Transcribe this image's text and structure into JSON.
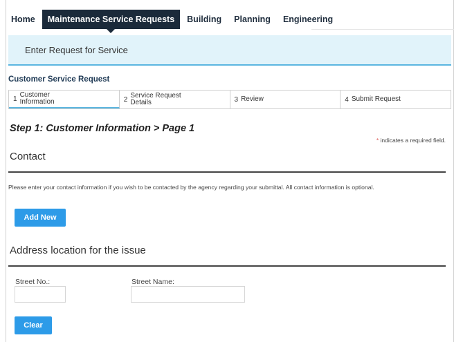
{
  "nav": {
    "items": [
      {
        "label": "Home"
      },
      {
        "label": "Maintenance Service Requests",
        "active": true
      },
      {
        "label": "Building"
      },
      {
        "label": "Planning"
      },
      {
        "label": "Engineering"
      }
    ]
  },
  "banner": {
    "text": "Enter Request for Service"
  },
  "form": {
    "title": "Customer Service Request",
    "steps": [
      {
        "num": "1",
        "label": "Customer\nInformation",
        "active": true
      },
      {
        "num": "2",
        "label": "Service Request\nDetails"
      },
      {
        "num": "3",
        "label": "Review"
      },
      {
        "num": "4",
        "label": "Submit Request"
      }
    ],
    "step_title": "Step 1: Customer Information > Page 1",
    "required_star": "*",
    "required_note": " indicates a required field."
  },
  "contact": {
    "title": "Contact",
    "info": "Please enter your contact information if you wish to be contacted by the agency regarding your submittal.  All contact information is optional.",
    "add_button": "Add New"
  },
  "address": {
    "title": "Address location for the issue",
    "street_no_label": "Street No.:",
    "street_no_value": "",
    "street_name_label": "Street Name:",
    "street_name_value": "",
    "clear_button": "Clear"
  },
  "colors": {
    "nav_active_bg": "#1b2a3a",
    "banner_bg": "#e1f3fa",
    "accent": "#5bb6e0",
    "button": "#2d9be8",
    "required": "#d9534f"
  }
}
